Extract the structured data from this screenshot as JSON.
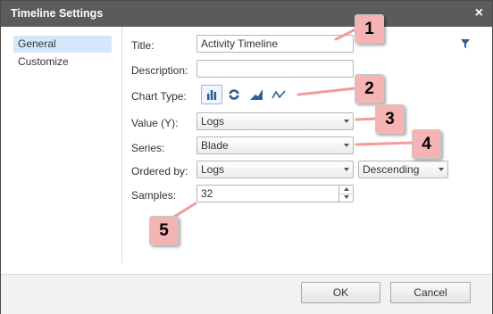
{
  "window": {
    "title": "Timeline Settings",
    "close_symbol": "×"
  },
  "sidebar": {
    "items": [
      {
        "label": "General",
        "selected": true
      },
      {
        "label": "Customize",
        "selected": false
      }
    ]
  },
  "form": {
    "title": {
      "label": "Title:",
      "value": "Activity Timeline"
    },
    "description": {
      "label": "Description:",
      "value": ""
    },
    "chart_type": {
      "label": "Chart Type:",
      "options": [
        "bar-chart-icon",
        "donut-chart-icon",
        "area-chart-icon",
        "line-chart-icon"
      ],
      "selected": "bar-chart-icon"
    },
    "value_y": {
      "label": "Value (Y):",
      "value": "Logs"
    },
    "series": {
      "label": "Series:",
      "value": "Blade"
    },
    "ordered_by": {
      "label": "Ordered by:",
      "value": "Logs",
      "direction": "Descending"
    },
    "samples": {
      "label": "Samples:",
      "value": "32"
    }
  },
  "buttons": {
    "ok": "OK",
    "cancel": "Cancel"
  },
  "callouts": [
    "1",
    "2",
    "3",
    "4",
    "5"
  ],
  "colors": {
    "titlebar": "#5b5b5b",
    "accent_icon": "#2e5f93",
    "callout_fill": "#f6b3b3",
    "callout_line": "#f29a9a"
  }
}
